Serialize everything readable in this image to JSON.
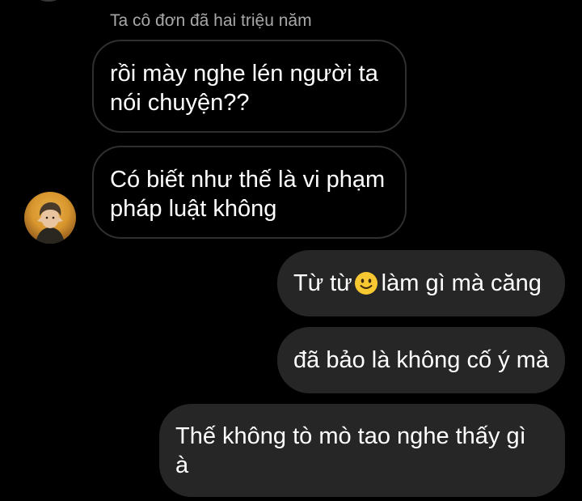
{
  "conversation": {
    "sender_name": "Ta cô đơn đã hai triệu năm",
    "messages": [
      {
        "direction": "incoming",
        "text": "rồi mày nghe lén người ta\nnói chuyện??"
      },
      {
        "direction": "incoming",
        "text": "Có biết như thế là vi phạm\npháp luật không"
      },
      {
        "direction": "outgoing",
        "text_before_emoji": "Từ từ",
        "emoji": "slightly-smiling-face",
        "text_after_emoji": "làm gì mà căng"
      },
      {
        "direction": "outgoing",
        "text": "đã bảo là không cố ý mà"
      },
      {
        "direction": "outgoing",
        "text": "Thế không tò mò tao nghe thấy gì\nà"
      }
    ]
  },
  "colors": {
    "background": "#000000",
    "outgoing_bubble": "#262626",
    "incoming_border": "#2f2f2f",
    "sender_name": "#a8a8a8",
    "text": "#ffffff",
    "emoji": "#f7c831"
  },
  "icons": {
    "avatar": "user-avatar-photo",
    "emoji": "slightly-smiling-face-emoji"
  }
}
